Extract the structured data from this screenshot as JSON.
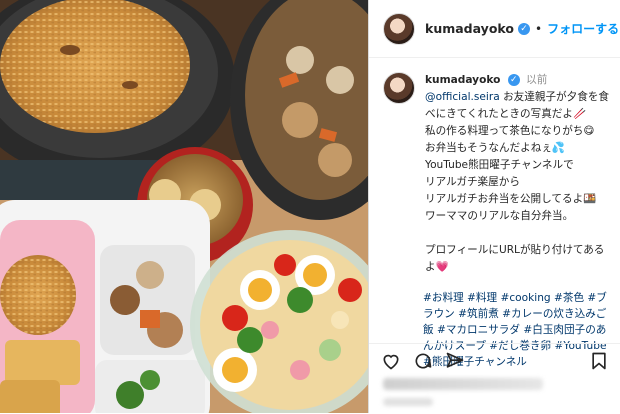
{
  "post": {
    "username": "kumadayoko",
    "follow_label": "フォローする",
    "caption": {
      "mention": "@official.seira",
      "time_label": "以前",
      "lines": [
        "お友達親子が夕食を食べにきてくれたときの写真だよ🥢",
        "私の作る料理って茶色になりがち😋",
        "お弁当もそうなんだよねぇ💦",
        "YouTube熊田曜子チャンネルで",
        "リアルガチ楽屋から",
        "リアルガチお弁当を公開してるよ🍱",
        "ワーママのリアルな自分弁当。",
        "プロフィールにURLが貼り付けてあるよ💗"
      ],
      "hashtags": "#お料理 #料理 #cooking #茶色 #ブラウン #筑前煮 #カレーの炊き込みご飯 #マカロニサラダ #白玉肉団子のあんかけスープ #だし巻き卵 #YouTube #熊田曜子チャンネル"
    },
    "photo_alt": "Dinner table with curry rice, chikuzenni, soup, bento and macaroni salad"
  }
}
